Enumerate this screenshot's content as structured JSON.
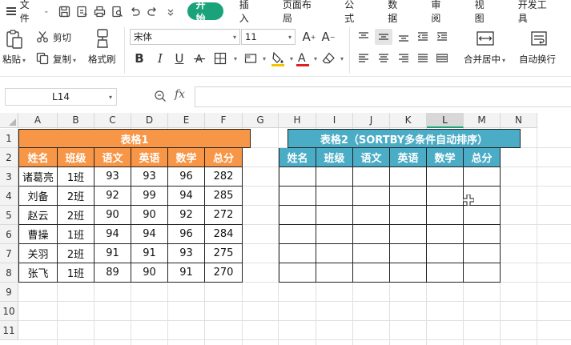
{
  "menubar": {
    "file_label": "文件",
    "tabs": [
      "开始",
      "插入",
      "页面布局",
      "公式",
      "数据",
      "审阅",
      "视图",
      "开发工具"
    ],
    "active_tab": "开始"
  },
  "ribbon": {
    "paste_label": "粘贴",
    "cut_label": "剪切",
    "copy_label": "复制",
    "format_painter_label": "格式刷",
    "font_name": "宋体",
    "font_size": "11",
    "merge_center_label": "合并居中",
    "wrap_text_label": "自动换行",
    "accent_color": "#1aa37a",
    "fill_color_bar": "#f5c400",
    "font_color_bar": "#e02020"
  },
  "formula_bar": {
    "cell_ref": "L14",
    "fx_label": "fx",
    "formula": ""
  },
  "sheet": {
    "columns": [
      "A",
      "B",
      "C",
      "D",
      "E",
      "F",
      "G",
      "H",
      "I",
      "J",
      "K",
      "L",
      "M",
      "N"
    ],
    "selected_column": "L",
    "rows": [
      "1",
      "2",
      "3",
      "4",
      "5",
      "6",
      "7",
      "8",
      "9",
      "10",
      "11"
    ],
    "table1": {
      "title": "表格1",
      "headers": [
        "姓名",
        "班级",
        "语文",
        "英语",
        "数学",
        "总分"
      ],
      "rows": [
        [
          "诸葛亮",
          "1班",
          "93",
          "93",
          "96",
          "282"
        ],
        [
          "刘备",
          "2班",
          "92",
          "99",
          "94",
          "285"
        ],
        [
          "赵云",
          "2班",
          "90",
          "90",
          "92",
          "272"
        ],
        [
          "曹操",
          "1班",
          "94",
          "94",
          "96",
          "284"
        ],
        [
          "关羽",
          "2班",
          "91",
          "91",
          "93",
          "275"
        ],
        [
          "张飞",
          "1班",
          "89",
          "90",
          "91",
          "270"
        ]
      ],
      "color": "#f79646"
    },
    "table2": {
      "title": "表格2（SORTBY多条件自动排序）",
      "headers": [
        "姓名",
        "班级",
        "语文",
        "英语",
        "数学",
        "总分"
      ],
      "color": "#4bacc6"
    }
  }
}
